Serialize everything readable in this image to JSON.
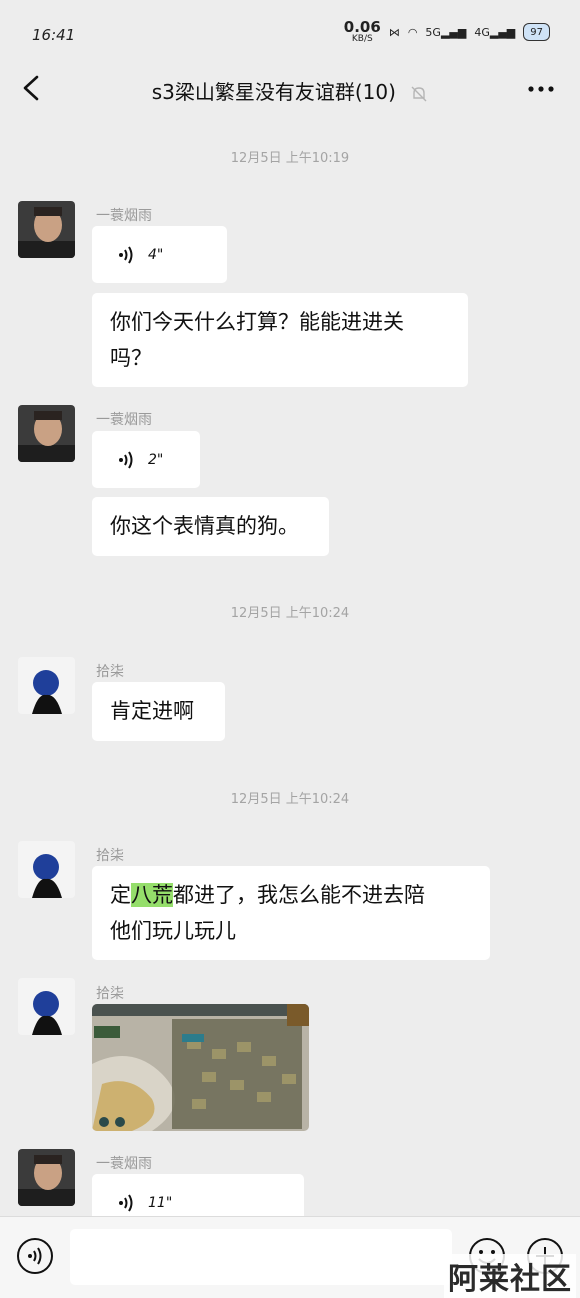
{
  "status_bar": {
    "time": "16:41",
    "speed_value": "0.06",
    "speed_unit": "KB/S",
    "sim1_label": "5G",
    "sim2_label": "4G",
    "battery": "97"
  },
  "nav": {
    "title": "s3梁山繁星没有友谊群(10)",
    "back_icon": "back-arrow-icon",
    "mute_icon": "bell-off-icon",
    "more_icon": "more-dots-icon"
  },
  "timestamps": [
    "12月5日 上午10:19",
    "12月5日 上午10:24",
    "12月5日 上午10:24"
  ],
  "messages": [
    {
      "sender": "一蓑烟雨",
      "type": "voice",
      "duration": "4\""
    },
    {
      "sender": "",
      "type": "text",
      "line1": "你们今天什么打算？能能进进关",
      "line2": "吗？"
    },
    {
      "sender": "一蓑烟雨",
      "type": "voice",
      "duration": "2\""
    },
    {
      "sender": "",
      "type": "text",
      "line1": "你这个表情真的狗。"
    },
    {
      "sender": "拾柒",
      "type": "text",
      "line1": "肯定进啊"
    },
    {
      "sender": "拾柒",
      "type": "text",
      "pre": "定",
      "highlight": "八荒",
      "line1": "都进了，我怎么能不进去陪",
      "line2": "他们玩儿玩儿"
    },
    {
      "sender": "拾柒",
      "type": "image"
    },
    {
      "sender": "一蓑烟雨",
      "type": "voice",
      "duration": "11\""
    }
  ],
  "input_bar": {
    "placeholder": "",
    "voice_icon": "voice-toggle-icon",
    "emoji_icon": "emoji-icon",
    "plus_icon": "plus-icon"
  },
  "watermark": "阿莱社区",
  "colors": {
    "background": "#ededed",
    "bubble": "#ffffff",
    "highlight": "#95de6b",
    "timestamp": "#a4a4a4"
  }
}
